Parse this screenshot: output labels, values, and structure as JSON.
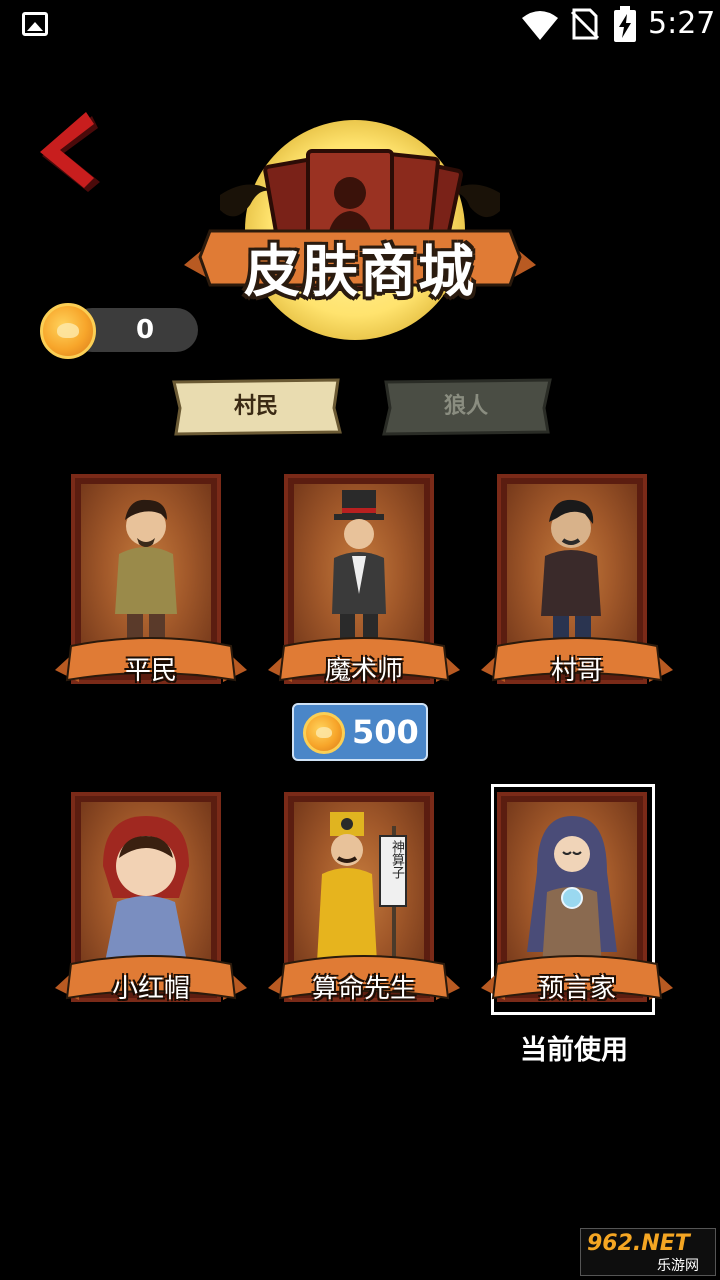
{
  "status_bar": {
    "time": "5:27",
    "icons": [
      "gallery-icon",
      "wifi-icon",
      "no-sim-icon",
      "battery-charging-icon"
    ]
  },
  "header": {
    "title": "皮肤商城",
    "back_icon": "chevron-left-icon"
  },
  "currency": {
    "coins": "0"
  },
  "tabs": [
    {
      "label": "村民",
      "active": true
    },
    {
      "label": "狼人",
      "active": false
    }
  ],
  "skins": [
    {
      "name": "平民"
    },
    {
      "name": "魔术师"
    },
    {
      "name": "村哥"
    },
    {
      "name": "小红帽"
    },
    {
      "name": "算命先生"
    },
    {
      "name": "预言家",
      "status": "当前使用"
    }
  ],
  "price": {
    "amount": "500"
  },
  "fortune_banner": "神算子",
  "watermark": {
    "brand": "962.NET",
    "sub": "乐游网"
  },
  "colors": {
    "background": "#000000",
    "price_button": "#4a86c8",
    "card_frame": "#5b1d10",
    "ribbon": "#e07b35",
    "coin": "#f7a52a"
  }
}
